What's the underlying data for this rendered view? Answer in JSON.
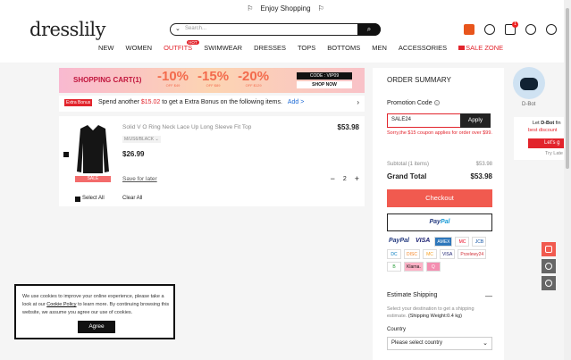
{
  "topbar": {
    "text": "Enjoy Shopping"
  },
  "header": {
    "logo": "dresslily",
    "search_placeholder": "Search...",
    "cart_count": "1",
    "nav": [
      "NEW",
      "WOMEN",
      "OUTFITS",
      "SWIMWEAR",
      "DRESSES",
      "TOPS",
      "BOTTOMS",
      "MEN",
      "ACCESSORIES",
      "SALE ZONE"
    ],
    "outfits_badge": "HOT"
  },
  "banner": {
    "title": "SHOPPING CART(1)",
    "discounts": [
      {
        "pct": "-10%",
        "sub": "OFF $49"
      },
      {
        "pct": "-15%",
        "sub": "OFF $89"
      },
      {
        "pct": "-20%",
        "sub": "OFF $129"
      }
    ],
    "code": "CODE : VIP09",
    "shop_now": "SHOP NOW"
  },
  "bonus": {
    "tag": "Extra Bonus",
    "text_a": "Spend another",
    "amount": "$15.02",
    "text_b": "to get a Extra Bonus on the following items.",
    "add": "Add",
    "add_arrow": ">"
  },
  "item": {
    "name": "Solid V O Ring Neck Lace Up Long Sleeve Fit Top",
    "variant": "M/US6/BLACK",
    "price": "$26.99",
    "total": "$53.98",
    "sale_tag": "SALE",
    "save_for_later": "Save for later",
    "qty": "2",
    "select_all": "Select All",
    "clear_all": "Clear All"
  },
  "summary": {
    "title": "ORDER SUMMARY",
    "promo_label": "Promotion Code",
    "promo_value": "SALE24",
    "apply": "Apply",
    "promo_error": "Sorry,the $15 coupon applies for order over $99.",
    "subtotal_label": "Subtotal (1 items)",
    "subtotal": "$53.98",
    "grand_label": "Grand Total",
    "grand": "$53.98",
    "checkout": "Checkout",
    "paypal_a": "Pay",
    "paypal_b": "Pal",
    "payments": [
      "PayPal",
      "VISA",
      "AMEX",
      "MC",
      "JCB",
      "DC",
      "DISC",
      "MC",
      "VISA",
      "Przelewy24",
      "B",
      "Klarna.",
      "Q"
    ],
    "estimate_title": "Estimate Shipping",
    "estimate_text": "Select your destination to get a shipping estimate.",
    "estimate_weight": "(Shipping Weight:0.4 kg)",
    "country_label": "Country",
    "country_placeholder": "Please select country"
  },
  "cookie": {
    "text_a": "We use cookies to improve your online experience, please take a look at our",
    "policy": "Cookie Policy",
    "text_b": "to learn more. By continuing browsing this website, we assume you agree our use of cookies.",
    "agree": "Agree"
  },
  "dbot": {
    "label": "D-Bot",
    "promo_a": "Let",
    "promo_b": "D-Bot",
    "promo_c": "fin",
    "promo_red": "best discount",
    "promo_btn": "Let's g",
    "try_later": "Try Late"
  }
}
